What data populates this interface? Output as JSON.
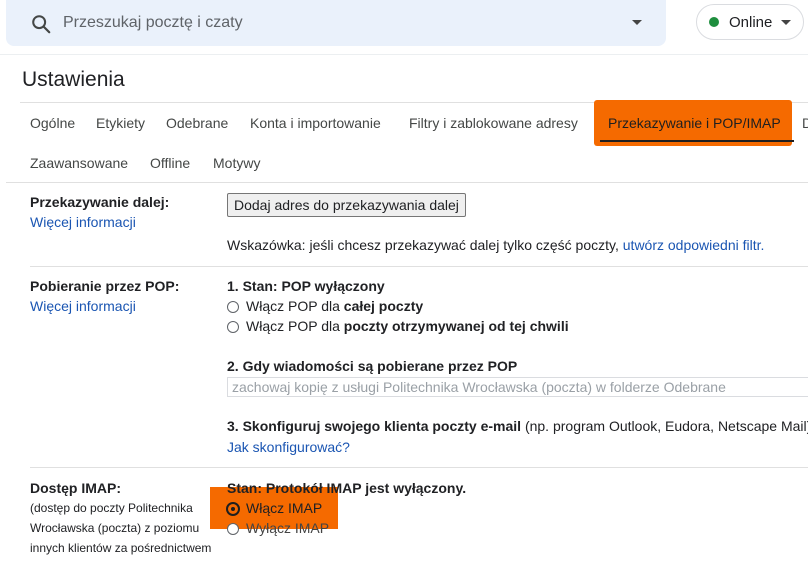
{
  "search": {
    "placeholder": "Przeszukaj pocztę i czaty"
  },
  "status": {
    "label": "Online",
    "color": "#1e8e3e"
  },
  "page_title": "Ustawienia",
  "tabs_row1": [
    "Ogólne",
    "Etykiety",
    "Odebrane",
    "Konta i importowanie",
    "Filtry i zablokowane adresy",
    "Przekazywanie i POP/IMAP",
    "D"
  ],
  "tabs_row2": [
    "Zaawansowane",
    "Offline",
    "Motywy"
  ],
  "active_tab": "Przekazywanie i POP/IMAP",
  "highlight_color": "#f56a00",
  "forwarding": {
    "label": "Przekazywanie dalej:",
    "more_info": "Więcej informacji",
    "button": "Dodaj adres do przekazywania dalej",
    "hint_prefix": "Wskazówka: jeśli chcesz przekazywać dalej tylko część poczty, ",
    "hint_link": "utwórz odpowiedni filtr."
  },
  "pop": {
    "label": "Pobieranie przez POP:",
    "more_info": "Więcej informacji",
    "status": "1. Stan: POP wyłączony",
    "option1_prefix": "Włącz POP dla ",
    "option1_bold": "całej poczty",
    "option2_prefix": "Włącz POP dla ",
    "option2_bold": "poczty otrzymywanej od tej chwili",
    "step2": "2. Gdy wiadomości są pobierane przez POP",
    "step2_select": "zachowaj kopię z usługi Politechnika Wrocławska (poczta) w folderze Odebrane",
    "step3_bold": "3. Skonfiguruj swojego klienta poczty e-mail",
    "step3_rest": " (np. program Outlook, Eudora, Netscape Mail)",
    "step3_link": "Jak skonfigurować?"
  },
  "imap": {
    "label": "Dostęp IMAP:",
    "desc_line1": "(dostęp do poczty Politechnika",
    "desc_line2": "Wrocławska (poczta) z poziomu",
    "desc_line3": "innych klientów za pośrednictwem",
    "status": "Stan: Protokół IMAP jest wyłączony.",
    "option_enable": "Włącz IMAP",
    "option_disable": "Wyłącz IMAP"
  }
}
